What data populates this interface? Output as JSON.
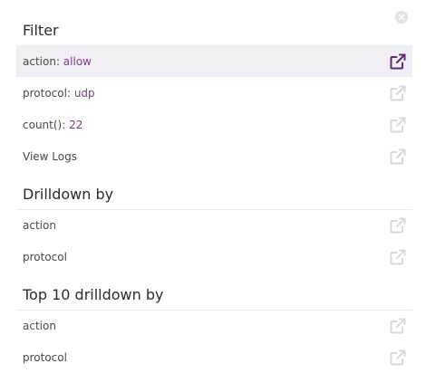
{
  "close": {
    "icon": "close-icon"
  },
  "filter": {
    "title": "Filter",
    "items": [
      {
        "key": "action: ",
        "value": "allow",
        "active": true
      },
      {
        "key": "protocol: ",
        "value": "udp",
        "active": false
      },
      {
        "key": "count(): ",
        "value": "22",
        "active": false
      },
      {
        "key": "View Logs",
        "value": "",
        "active": false
      }
    ]
  },
  "drilldown": {
    "title": "Drilldown by",
    "items": [
      {
        "label": "action"
      },
      {
        "label": "protocol"
      }
    ]
  },
  "top10": {
    "title": "Top 10 drilldown by",
    "items": [
      {
        "label": "action"
      },
      {
        "label": "protocol"
      }
    ]
  },
  "colors": {
    "active_row_bg": "#f1eef5",
    "value_text": "#7b3f8a",
    "active_icon": "#5a2d6a",
    "muted_icon": "#d9d9dd"
  },
  "icons": {
    "row_action": "external-link-icon"
  }
}
